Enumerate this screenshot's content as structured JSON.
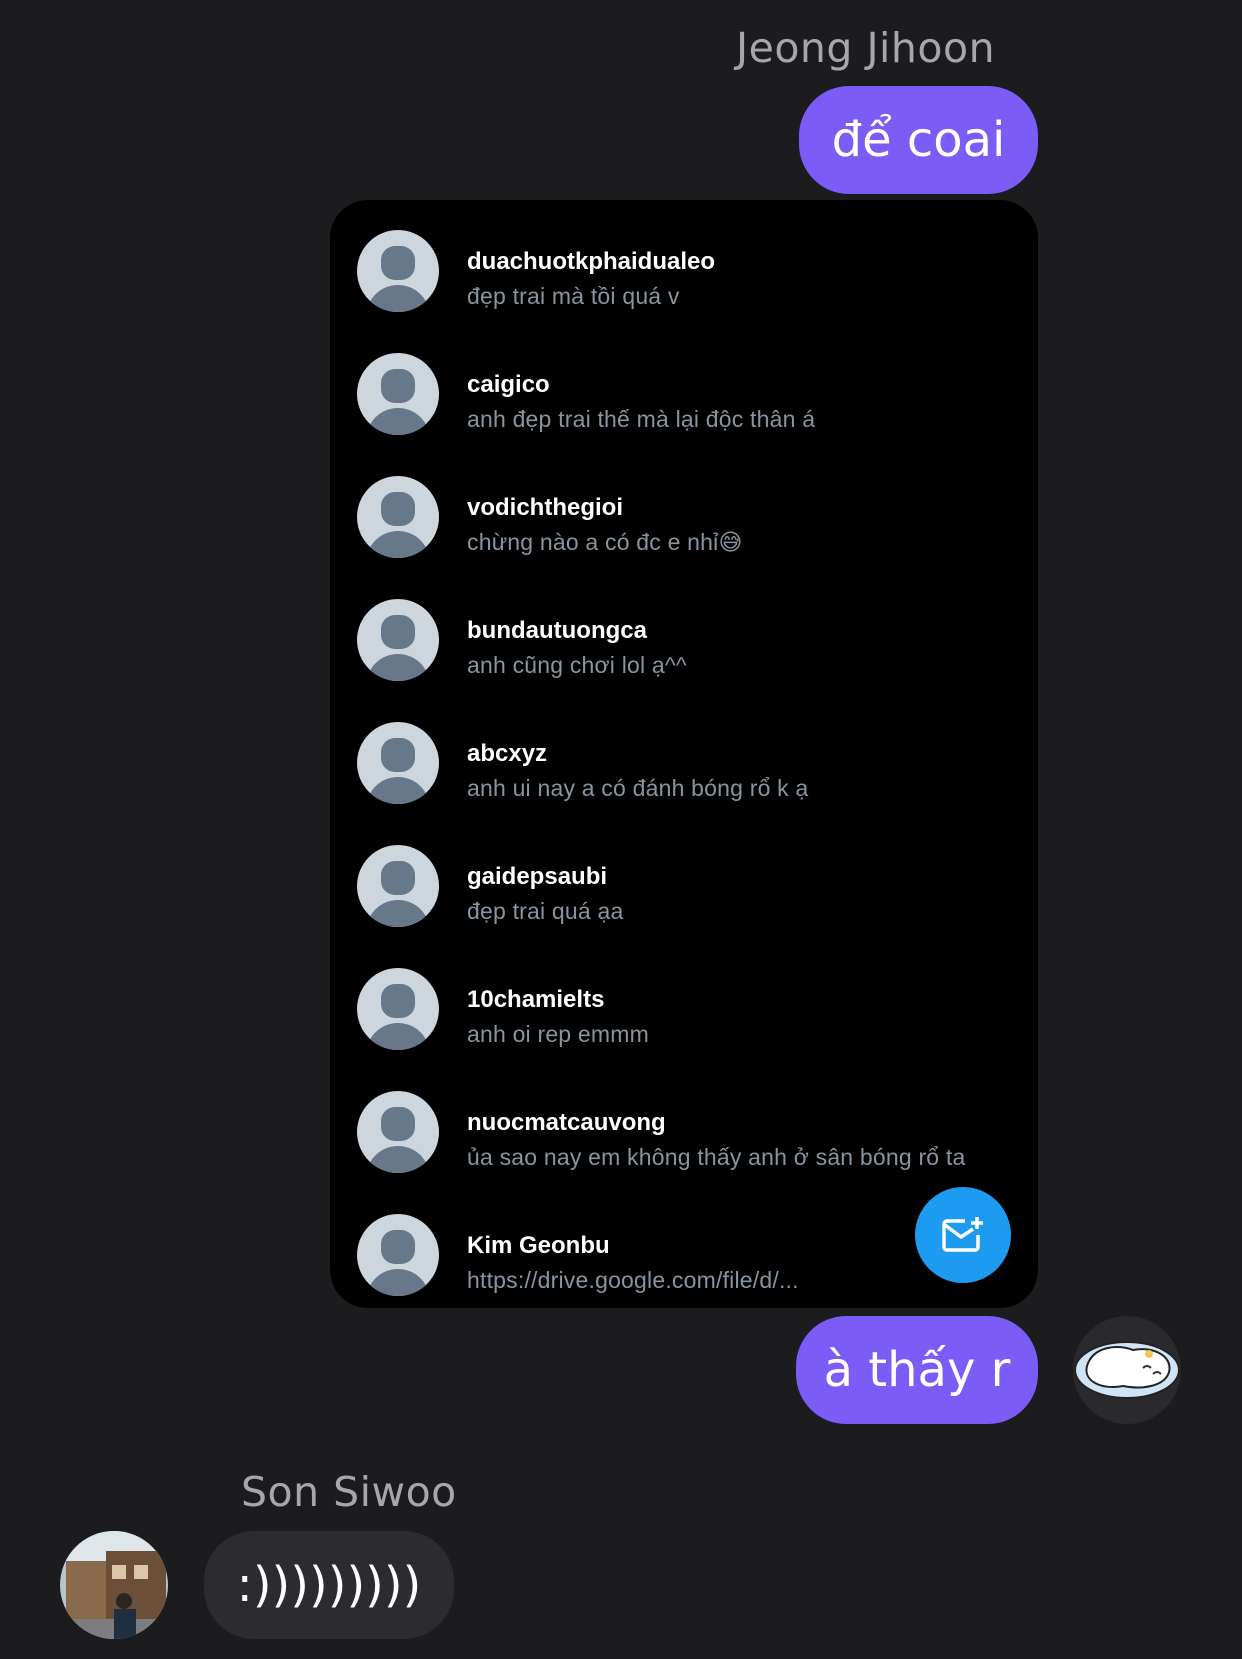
{
  "conversation": {
    "sender_1": "Jeong Jihoon",
    "msg_1": "để coai",
    "msg_2": "à thấy r",
    "sender_2": "Son Siwoo",
    "msg_3": ":)))))))))"
  },
  "shared_screenshot": {
    "rows": [
      {
        "username": "duachuotkphaidualeo",
        "preview": "đẹp trai mà tồi quá v"
      },
      {
        "username": "caigico",
        "preview": "anh đẹp trai thế mà lại độc thân á"
      },
      {
        "username": "vodichthegioi",
        "preview": "chừng nào a có đc e nhỉ😅"
      },
      {
        "username": "bundautuongca",
        "preview": "anh cũng chơi lol ạ^^"
      },
      {
        "username": "abcxyz",
        "preview": "anh ui nay a có đánh bóng rổ k ạ"
      },
      {
        "username": "gaidepsaubi",
        "preview": "đẹp trai quá ạa"
      },
      {
        "username": "10chamielts",
        "preview": "anh oi rep emmm"
      },
      {
        "username": "nuocmatcauvong",
        "preview": "ủa sao nay em không thấy anh ở sân bóng rổ ta"
      },
      {
        "username": "Kim Geonbu",
        "preview": "https://drive.google.com/file/d/..."
      }
    ],
    "fab_icon": "new-message-icon"
  },
  "colors": {
    "background": "#1c1c1f",
    "outgoing_bubble": "#7b5cf6",
    "incoming_bubble": "#2b2b30",
    "fab": "#1d9bf0"
  }
}
